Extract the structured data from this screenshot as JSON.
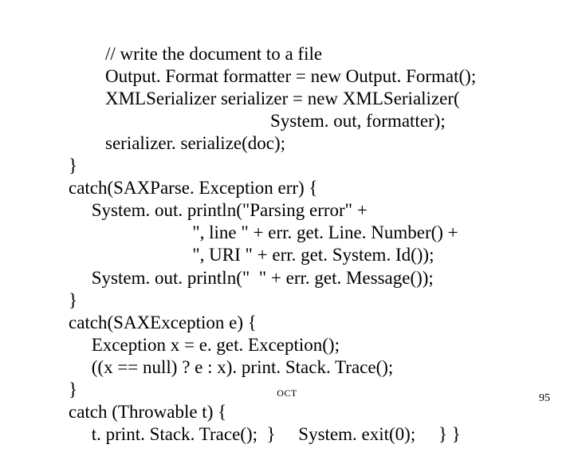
{
  "code": {
    "l1": "        // write the document to a file",
    "l2": "        Output. Format formatter = new Output. Format();",
    "l3": "        XMLSerializer serializer = new XMLSerializer(",
    "l4": "                                            System. out, formatter);",
    "l5": "        serializer. serialize(doc);",
    "l6": "}",
    "l7": "catch(SAXParse. Exception err) {",
    "l8": "     System. out. println(\"Parsing error\" +",
    "l9": "                           \", line \" + err. get. Line. Number() +",
    "l10": "                           \", URI \" + err. get. System. Id());",
    "l11": "     System. out. println(\"  \" + err. get. Message());",
    "l12": "}",
    "l13": "catch(SAXException e) {",
    "l14": "     Exception x = e. get. Exception();",
    "l15": "     ((x == null) ? e : x). print. Stack. Trace();",
    "l16": "}",
    "l17": "catch (Throwable t) {",
    "l18": "     t. print. Stack. Trace();  }     System. exit(0);     } }"
  },
  "footer": {
    "center": "OCT",
    "pageNumber": "95"
  }
}
